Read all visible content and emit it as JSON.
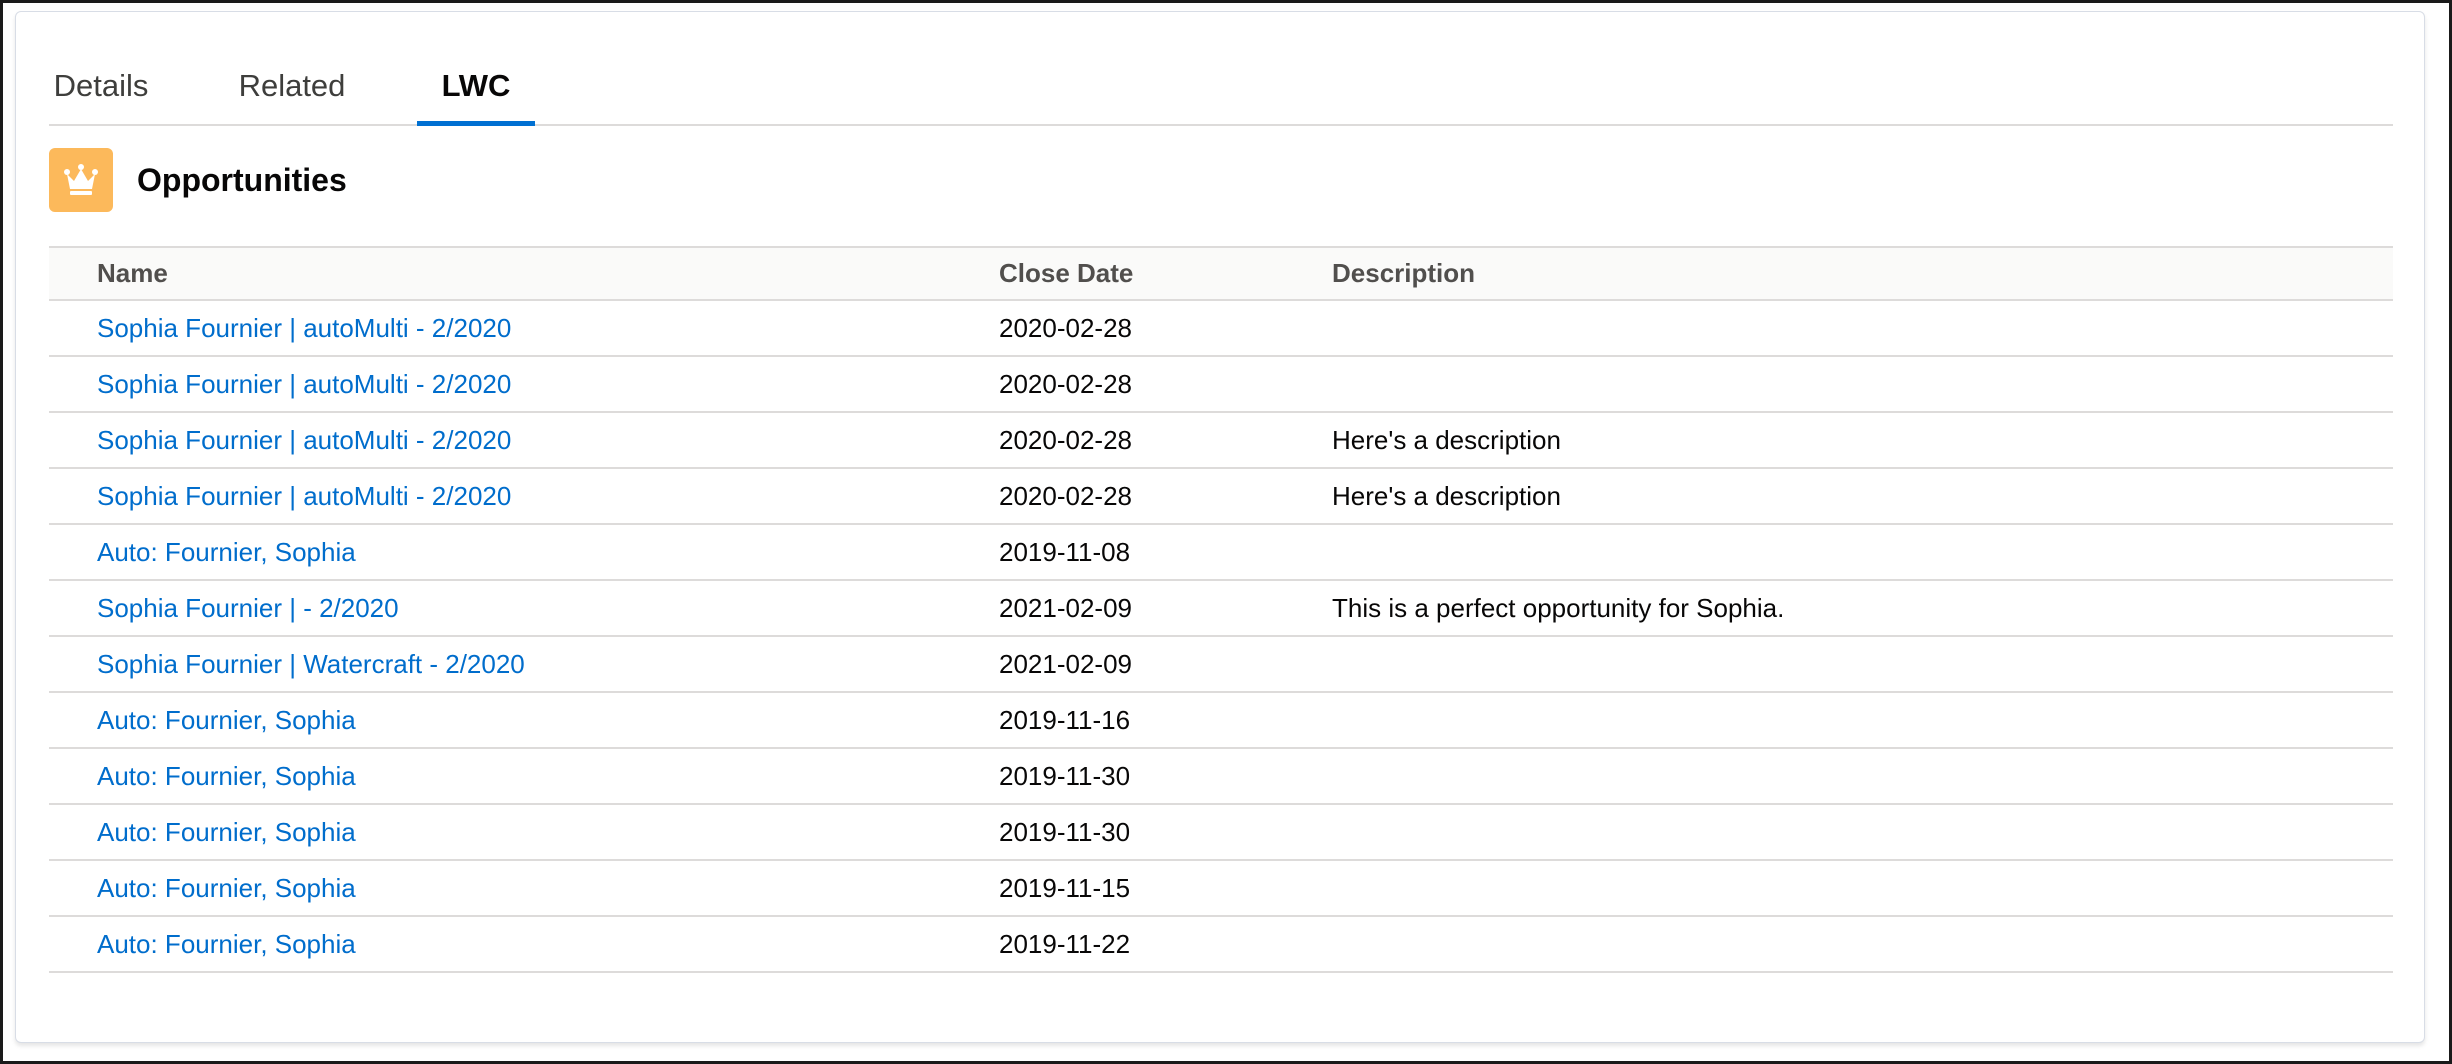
{
  "tabs": [
    {
      "label": "Details",
      "active": false
    },
    {
      "label": "Related",
      "active": false
    },
    {
      "label": "LWC",
      "active": true
    }
  ],
  "card": {
    "title": "Opportunities",
    "icon": "crown-icon",
    "icon_color": "#fcb95b"
  },
  "table": {
    "columns": [
      "Name",
      "Close Date",
      "Description"
    ],
    "rows": [
      {
        "name": "Sophia Fournier | autoMulti - 2/2020",
        "close_date": "2020-02-28",
        "description": ""
      },
      {
        "name": "Sophia Fournier | autoMulti - 2/2020",
        "close_date": "2020-02-28",
        "description": ""
      },
      {
        "name": "Sophia Fournier | autoMulti - 2/2020",
        "close_date": "2020-02-28",
        "description": "Here's a description"
      },
      {
        "name": "Sophia Fournier | autoMulti - 2/2020",
        "close_date": "2020-02-28",
        "description": "Here's a description"
      },
      {
        "name": "Auto: Fournier, Sophia",
        "close_date": "2019-11-08",
        "description": ""
      },
      {
        "name": "Sophia Fournier | - 2/2020",
        "close_date": "2021-02-09",
        "description": "This is a perfect opportunity for Sophia."
      },
      {
        "name": "Sophia Fournier | Watercraft - 2/2020",
        "close_date": "2021-02-09",
        "description": ""
      },
      {
        "name": "Auto: Fournier, Sophia",
        "close_date": "2019-11-16",
        "description": ""
      },
      {
        "name": "Auto: Fournier, Sophia",
        "close_date": "2019-11-30",
        "description": ""
      },
      {
        "name": "Auto: Fournier, Sophia",
        "close_date": "2019-11-30",
        "description": ""
      },
      {
        "name": "Auto: Fournier, Sophia",
        "close_date": "2019-11-15",
        "description": ""
      },
      {
        "name": "Auto: Fournier, Sophia",
        "close_date": "2019-11-22",
        "description": ""
      }
    ]
  },
  "colors": {
    "link": "#006dcc",
    "tab_active_underline": "#0070d2"
  }
}
